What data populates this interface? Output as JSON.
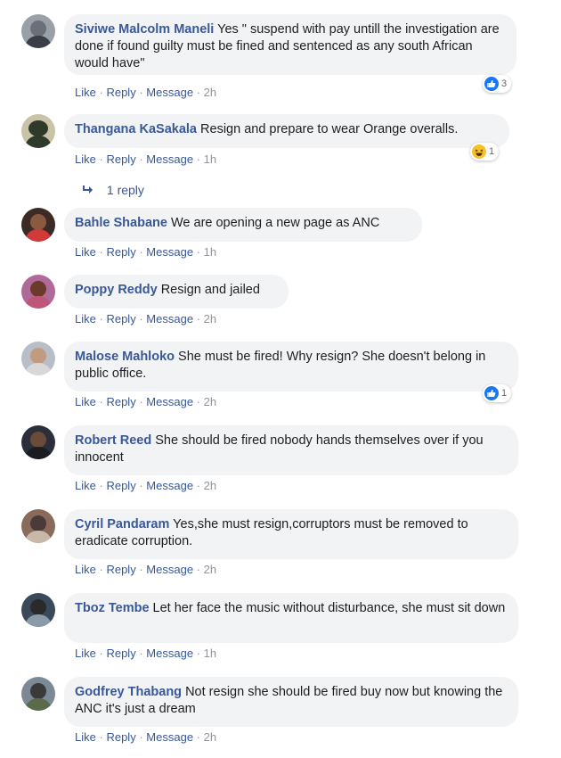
{
  "actions": {
    "like": "Like",
    "reply": "Reply",
    "message": "Message",
    "dot": "·"
  },
  "comments": [
    {
      "name": "Siviwe Malcolm Maneli",
      "text": "Yes \" suspend with pay untill the investigation are done if found guilty must be fined and sentenced as any south African would have\"",
      "time": "2h",
      "reaction": {
        "type": "like",
        "count": "3"
      },
      "avatar_colors": [
        "#6b7078",
        "#3a3f47"
      ]
    },
    {
      "name": "Thangana KaSakala",
      "text": "Resign and prepare to wear Orange overalls.",
      "time": "1h",
      "reaction": {
        "type": "haha",
        "count": "1"
      },
      "avatar_colors": [
        "#c9c3a8",
        "#2f3a2a"
      ]
    },
    {
      "name": "Bahle Shabane",
      "text": "We are opening a new page as ANC",
      "time": "1h",
      "reaction": null,
      "avatar_colors": [
        "#3b2a25",
        "#d23a3a"
      ]
    },
    {
      "name": "Poppy Reddy",
      "text": "Resign and jailed",
      "time": "2h",
      "reaction": null,
      "avatar_colors": [
        "#7a4a6e",
        "#c0557a"
      ]
    },
    {
      "name": "Malose Mahloko",
      "text": "She must be fired! Why resign? She doesn't belong in public office.",
      "time": "2h",
      "reaction": {
        "type": "like",
        "count": "1"
      },
      "avatar_colors": [
        "#b8bec7",
        "#d8d8d8"
      ]
    },
    {
      "name": "Robert Reed",
      "text": "She should be fired nobody hands themselves over if you innocent",
      "time": "2h",
      "reaction": null,
      "avatar_colors": [
        "#2b2f3a",
        "#6a4b3a"
      ]
    },
    {
      "name": "Cyril Pandaram",
      "text": "Yes,she must resign,corruptors must be removed to eradicate corruption.",
      "time": "2h",
      "reaction": null,
      "avatar_colors": [
        "#8a6a5a",
        "#4a3a3a"
      ]
    },
    {
      "name": "Tboz Tembe",
      "text": "Let her face the music without disturbance, she must sit down",
      "time": "1h",
      "reaction": null,
      "avatar_colors": [
        "#3a4a5a",
        "#2a2a2a"
      ]
    },
    {
      "name": "Godfrey Thabang",
      "text": "Not resign she should be fired buy now but knowing the ANC it's just a dream",
      "time": "2h",
      "reaction": null,
      "avatar_colors": [
        "#7c8a98",
        "#3a3a3a"
      ]
    }
  ],
  "reply_link": {
    "label": "1 reply"
  }
}
